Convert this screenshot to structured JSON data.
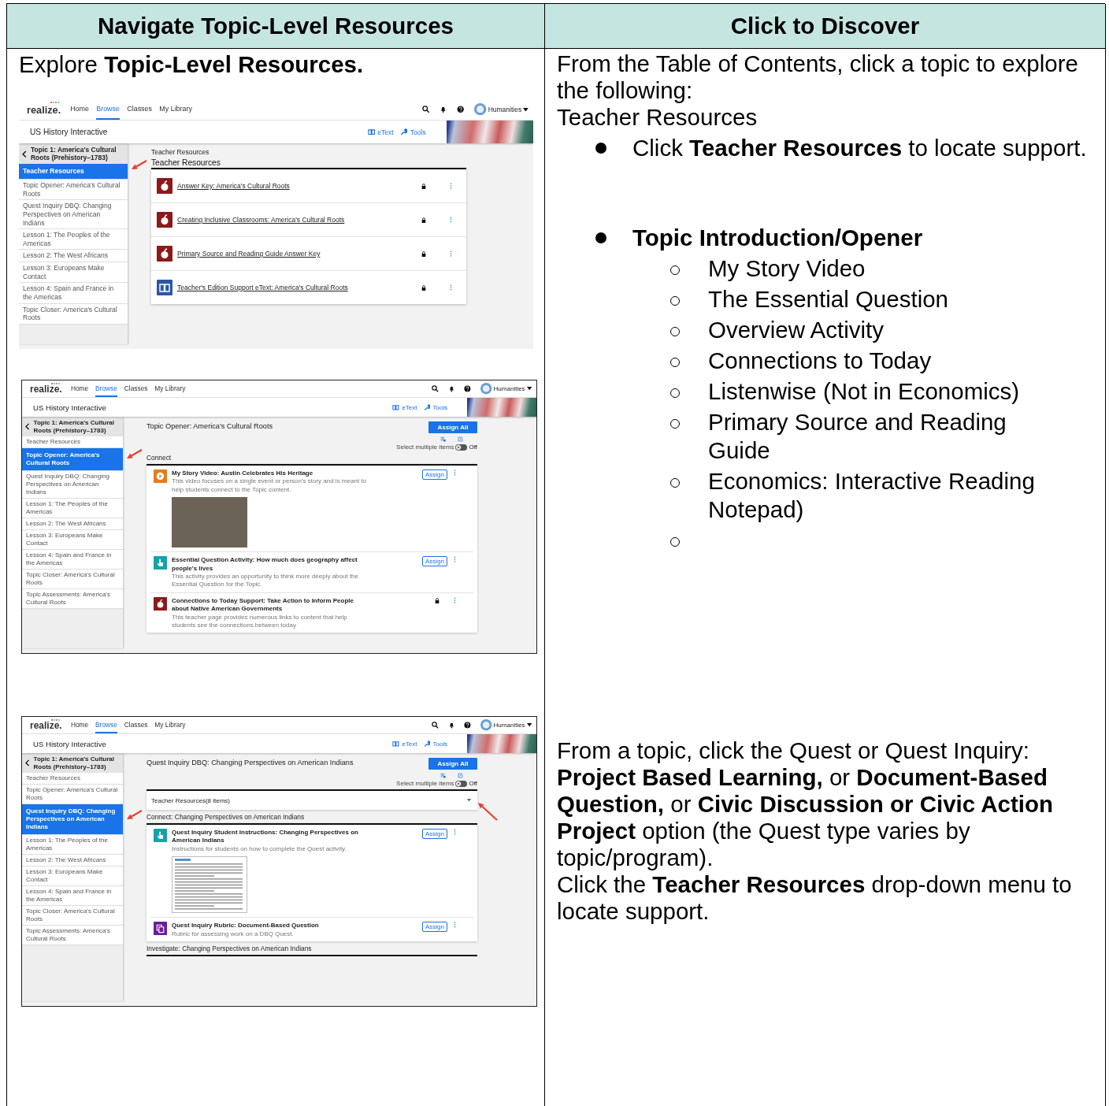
{
  "header": {
    "left": "Navigate Topic-Level Resources",
    "right": "Click to Discover"
  },
  "left": {
    "intro": "Explore **Topic-Level Resources.**",
    "screenshots": [
      {
        "framed": false,
        "nav": {
          "logo": "realize.",
          "links": [
            {
              "label": "Home",
              "selected": false
            },
            {
              "label": "Browse",
              "selected": true
            },
            {
              "label": "Classes",
              "selected": false
            },
            {
              "label": "My Library",
              "selected": false
            }
          ],
          "account": "Humanities"
        },
        "course": "US History Interactive",
        "etext": "eText",
        "tools": "Tools",
        "sidebar": {
          "title": "Topic 1: America's Cultural Roots (Prehistory–1783)",
          "items": [
            {
              "label": "Teacher Resources",
              "selected": true
            },
            {
              "label": "Topic Opener: America's Cultural Roots",
              "selected": false
            },
            {
              "label": "Quest Inquiry DBQ: Changing Perspectives on American Indians",
              "selected": false
            },
            {
              "label": "Lesson 1: The Peoples of the Americas",
              "selected": false
            },
            {
              "label": "Lesson 2: The West Africans",
              "selected": false
            },
            {
              "label": "Lesson 3: Europeans Make Contact",
              "selected": false
            },
            {
              "label": "Lesson 4: Spain and France in the Americas",
              "selected": false
            },
            {
              "label": "Topic Closer: America's Cultural Roots",
              "selected": false
            }
          ]
        },
        "content": {
          "kind": "resource_list",
          "breadcrumb": "Teacher Resources",
          "heading": "Teacher Resources",
          "items": [
            {
              "kind": "apple",
              "title": "Answer Key: America's Cultural Roots",
              "locked": true
            },
            {
              "kind": "apple",
              "title": "Creating Inclusive Classrooms: America's Cultural Roots",
              "locked": true
            },
            {
              "kind": "apple",
              "title": "Primary Source and Reading Guide Answer Key",
              "locked": true
            },
            {
              "kind": "book",
              "title": "Teacher's Edition Support eText: America's Cultural Roots",
              "locked": true
            }
          ]
        }
      },
      {
        "framed": true,
        "nav": {
          "logo": "realize.",
          "links": [
            {
              "label": "Home",
              "selected": false
            },
            {
              "label": "Browse",
              "selected": true
            },
            {
              "label": "Classes",
              "selected": false
            },
            {
              "label": "My Library",
              "selected": false
            }
          ],
          "account": "Humanities"
        },
        "course": "US History Interactive",
        "etext": "eText",
        "tools": "Tools",
        "sidebar": {
          "title": "Topic 1: America's Cultural Roots (Prehistory–1783)",
          "items": [
            {
              "label": "Teacher Resources",
              "selected": false
            },
            {
              "label": "Topic Opener: America's Cultural Roots",
              "selected": true
            },
            {
              "label": "Quest Inquiry DBQ: Changing Perspectives on American Indians",
              "selected": false
            },
            {
              "label": "Lesson 1: The Peoples of the Americas",
              "selected": false
            },
            {
              "label": "Lesson 2: The West Africans",
              "selected": false
            },
            {
              "label": "Lesson 3: Europeans Make Contact",
              "selected": false
            },
            {
              "label": "Lesson 4: Spain and France in the Americas",
              "selected": false
            },
            {
              "label": "Topic Closer: America's Cultural Roots",
              "selected": false
            },
            {
              "label": "Topic Assessments: America's Cultural Roots",
              "selected": false
            }
          ]
        },
        "content": {
          "kind": "topic",
          "title": "Topic Opener: America's Cultural Roots",
          "assign_all": "Assign All",
          "toggle": {
            "label": "Select multiple items",
            "on": false,
            "state_text": "Off"
          },
          "sections": [
            {
              "heading": "Connect",
              "items": [
                {
                  "kind": "play",
                  "title": "My Story Video: Austin Celebrates His Heritage",
                  "description": "This video focuses on a single event or person's story and is meant to help students connect to the Topic content.",
                  "assign_label": "Assign",
                  "photo": true
                },
                {
                  "kind": "hand",
                  "title": "Essential Question Activity: How much does geography affect people's lives",
                  "description": "This activity provides an opportunity to think more deeply about the Essential Question for the Topic.",
                  "assign_label": "Assign"
                },
                {
                  "kind": "apple",
                  "title": "Connections to Today Support: Take Action to Inform People about Native American Governments",
                  "description": "This teacher page provides numerous links to content that help students see the connections between today",
                  "locked": true
                }
              ]
            }
          ]
        }
      },
      {
        "framed": true,
        "nav": {
          "logo": "realize.",
          "links": [
            {
              "label": "Home",
              "selected": false
            },
            {
              "label": "Browse",
              "selected": true
            },
            {
              "label": "Classes",
              "selected": false
            },
            {
              "label": "My Library",
              "selected": false
            }
          ],
          "account": "Humanities"
        },
        "course": "US History Interactive",
        "etext": "eText",
        "tools": "Tools",
        "sidebar": {
          "title": "Topic 1: America's Cultural Roots (Prehistory–1783)",
          "items": [
            {
              "label": "Teacher Resources",
              "selected": false
            },
            {
              "label": "Topic Opener: America's Cultural Roots",
              "selected": false
            },
            {
              "label": "Quest Inquiry DBQ: Changing Perspectives on American Indians",
              "selected": true
            },
            {
              "label": "Lesson 1: The Peoples of the Americas",
              "selected": false
            },
            {
              "label": "Lesson 2: The West Africans",
              "selected": false
            },
            {
              "label": "Lesson 3: Europeans Make Contact",
              "selected": false
            },
            {
              "label": "Lesson 4: Spain and France in the Americas",
              "selected": false
            },
            {
              "label": "Topic Closer: America's Cultural Roots",
              "selected": false
            },
            {
              "label": "Topic Assessments: America's Cultural Roots",
              "selected": false
            }
          ]
        },
        "content": {
          "kind": "topic",
          "title": "Quest Inquiry DBQ: Changing Perspectives on American Indians",
          "assign_all": "Assign All",
          "toggle": {
            "label": "Select multiple items",
            "on": false,
            "state_text": "Off"
          },
          "dropdown": {
            "label": "Teacher Resources(8 items)",
            "expanded": false
          },
          "sections": [
            {
              "heading": "Connect: Changing Perspectives on American Indians",
              "items": [
                {
                  "kind": "hand",
                  "title": "Quest Inquiry Student Instructions: Changing Perspectives on American Indians",
                  "description": "Instructions for students on how to complete the Quest activity.",
                  "assign_label": "Assign",
                  "document_preview": true
                },
                {
                  "kind": "rubric",
                  "title": "Quest Inquiry Rubric: Document-Based Question",
                  "description": "Rubric for assessing work on a DBQ Quest.",
                  "assign_label": "Assign"
                }
              ]
            },
            {
              "heading": "Investigate: Changing Perspectives on American Indians"
            }
          ]
        }
      }
    ]
  },
  "right": {
    "intro": "From the Table of Contents, click a topic to explore the following:",
    "section_label": "Teacher Resources",
    "bullets": [
      {
        "text": "Click **Teacher Resources** to locate support.",
        "bold": false
      },
      {
        "text": "Topic Introduction/Opener",
        "bold": true,
        "children": [
          {
            "kind": "text",
            "text": "My Story Video"
          },
          {
            "kind": "text",
            "text": "The Essential Question"
          },
          {
            "kind": "text",
            "text": "Overview Activity"
          },
          {
            "kind": "text",
            "text": "Connections to Today"
          },
          {
            "kind": "text",
            "text": "Listenwise (Not in Economics)"
          },
          {
            "kind": "text",
            "text": "Primary Source and Reading Guide"
          },
          {
            "kind": "text",
            "text": "Economics: Interactive Reading Notepad)"
          },
          {
            "kind": "blank"
          }
        ]
      }
    ],
    "quest_paragraph": "From a topic, click the Quest or Quest Inquiry: **Project Based Learning,** or **Document-Based Question,** or **Civic Discussion or Civic Action Project** option (the Quest type varies by topic/program).",
    "dropdown_paragraph": "Click the **Teacher Resources** drop-down menu to locate support."
  }
}
